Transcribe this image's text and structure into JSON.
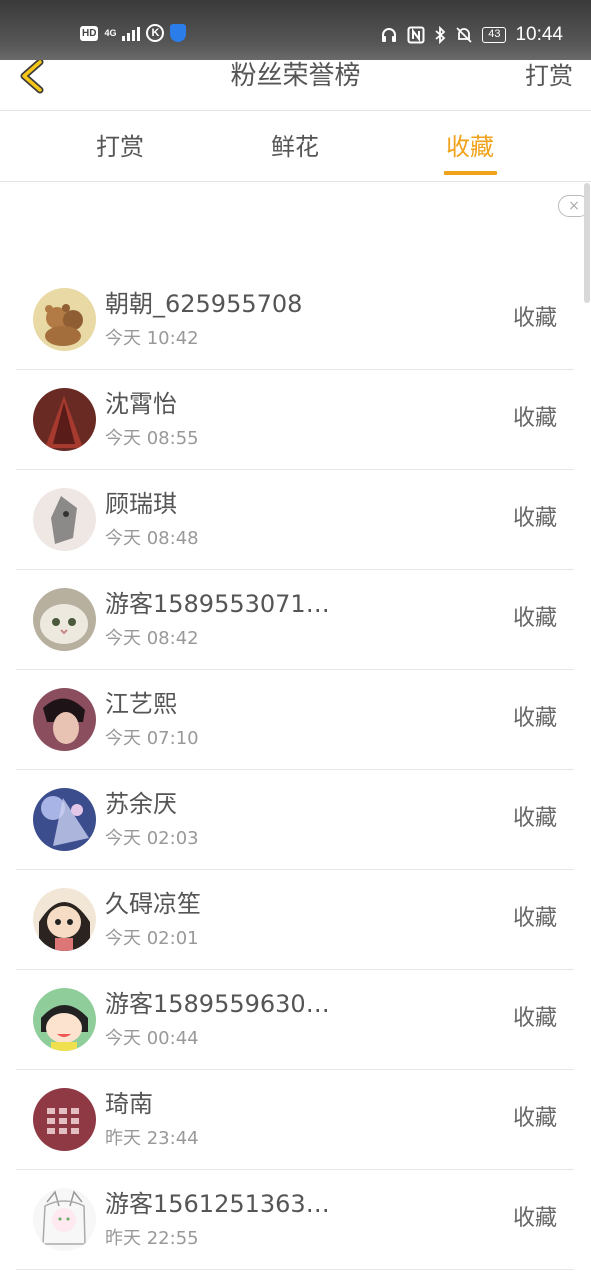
{
  "status_bar": {
    "hd": "HD",
    "network": "4G",
    "k_badge": "K",
    "battery": "43",
    "time": "10:44"
  },
  "header": {
    "title": "粉丝荣誉榜",
    "right_action": "打赏"
  },
  "tabs": [
    {
      "label": "打赏",
      "active": false
    },
    {
      "label": "鲜花",
      "active": false
    },
    {
      "label": "收藏",
      "active": true
    }
  ],
  "accent_color": "#f0a21a",
  "ad_close": "×",
  "rows": [
    {
      "name": "朝朝_625955708",
      "time": "今天 10:42",
      "action": "收藏",
      "avatar": "teddy-bear-avatar"
    },
    {
      "name": "沈霄怡",
      "time": "今天 08:55",
      "action": "收藏",
      "avatar": "red-hood-avatar"
    },
    {
      "name": "顾瑞琪",
      "time": "今天 08:48",
      "action": "收藏",
      "avatar": "cat-sketch-avatar"
    },
    {
      "name": "游客1589553071…",
      "time": "今天 08:42",
      "action": "收藏",
      "avatar": "white-cat-avatar"
    },
    {
      "name": "江艺熙",
      "time": "今天 07:10",
      "action": "收藏",
      "avatar": "portrait-avatar"
    },
    {
      "name": "苏余厌",
      "time": "今天 02:03",
      "action": "收藏",
      "avatar": "blue-art-avatar"
    },
    {
      "name": "久碍凉笙",
      "time": "今天 02:01",
      "action": "收藏",
      "avatar": "cartoon-girl-avatar"
    },
    {
      "name": "游客1589559630…",
      "time": "今天 00:44",
      "action": "收藏",
      "avatar": "maruko-avatar"
    },
    {
      "name": "琦南",
      "time": "昨天 23:44",
      "action": "收藏",
      "avatar": "text-avatar"
    },
    {
      "name": "游客1561251363…",
      "time": "昨天 22:55",
      "action": "收藏",
      "avatar": "anime-sketch-avatar"
    }
  ]
}
